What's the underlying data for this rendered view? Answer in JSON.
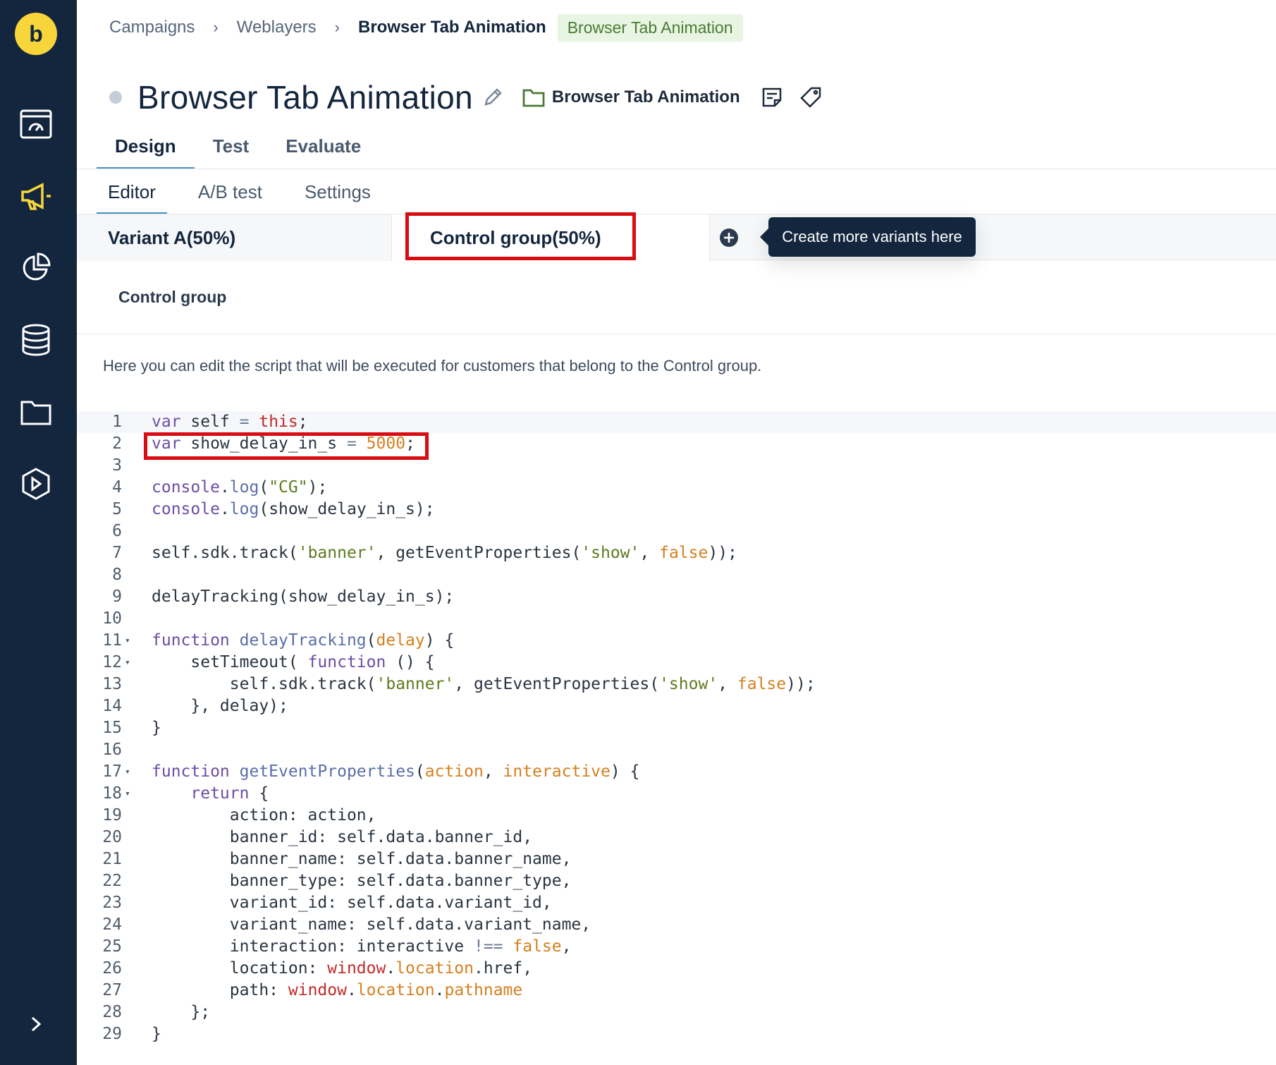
{
  "sidebar": {
    "logo_letter": "b",
    "items": [
      "dashboard-icon",
      "megaphone-icon",
      "pie-chart-icon",
      "database-icon",
      "folder-icon",
      "play-icon"
    ],
    "expand_icon": "chevron-right-icon",
    "active_color": "#f7d53b"
  },
  "breadcrumb": {
    "items": [
      "Campaigns",
      "Weblayers",
      "Browser Tab Animation"
    ],
    "chip": "Browser Tab Animation"
  },
  "header": {
    "title": "Browser Tab Animation",
    "folder": "Browser Tab Animation"
  },
  "tabs": [
    "Design",
    "Test",
    "Evaluate"
  ],
  "subtabs": [
    "Editor",
    "A/B test",
    "Settings"
  ],
  "variants": {
    "a": "Variant A(50%)",
    "control": "Control group(50%)",
    "tooltip": "Create more variants here"
  },
  "panel": {
    "title": "Control group",
    "description": "Here you can edit the script that will be executed for customers that belong to the Control group."
  },
  "code": {
    "line_numbers": [
      "1",
      "2",
      "3",
      "4",
      "5",
      "6",
      "7",
      "8",
      "9",
      "10",
      "11",
      "12",
      "13",
      "14",
      "15",
      "16",
      "17",
      "18",
      "19",
      "20",
      "21",
      "22",
      "23",
      "24",
      "25",
      "26",
      "27",
      "28",
      "29"
    ],
    "lines": [
      "var self = this;",
      "var show_delay_in_s = 5000;",
      "",
      "console.log(\"CG\");",
      "console.log(show_delay_in_s);",
      "",
      "self.sdk.track('banner', getEventProperties('show', false));",
      "",
      "delayTracking(show_delay_in_s);",
      "",
      "function delayTracking(delay) {",
      "    setTimeout( function () {",
      "        self.sdk.track('banner', getEventProperties('show', false));",
      "    }, delay);",
      "}",
      "",
      "function getEventProperties(action, interactive) {",
      "    return {",
      "        action: action,",
      "        banner_id: self.data.banner_id,",
      "        banner_name: self.data.banner_name,",
      "        banner_type: self.data.banner_type,",
      "        variant_id: self.data.variant_id,",
      "        variant_name: self.data.variant_name,",
      "        interaction: interactive !== false,",
      "        location: window.location.href,",
      "        path: window.location.pathname",
      "    };",
      "}"
    ]
  }
}
